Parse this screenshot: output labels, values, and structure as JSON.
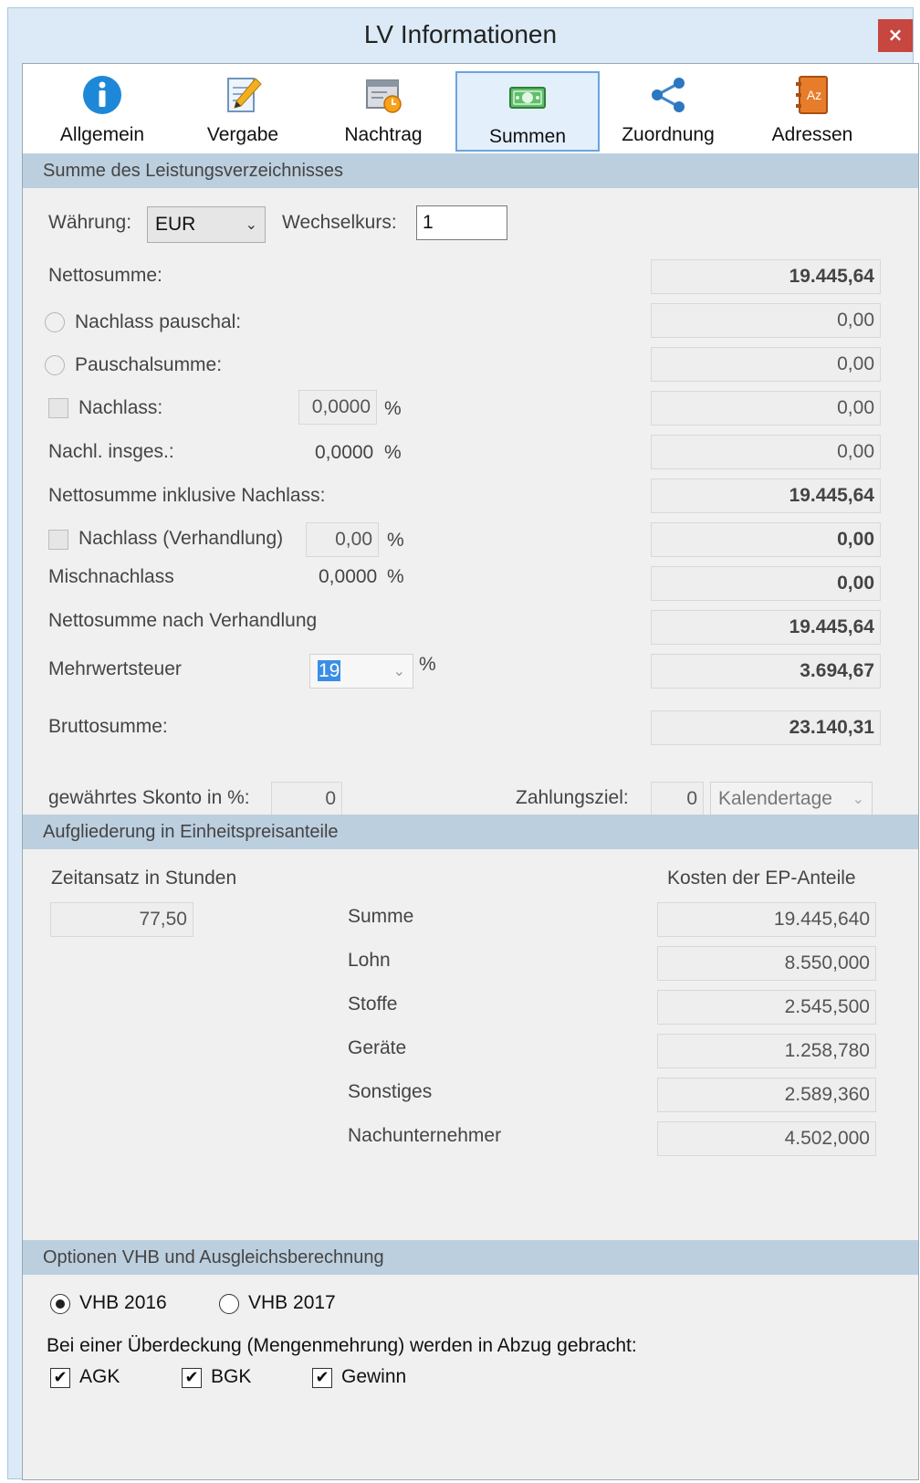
{
  "window": {
    "title": "LV Informationen",
    "close_glyph": "×"
  },
  "tabs": [
    {
      "label": "Allgemein",
      "icon": "info-icon"
    },
    {
      "label": "Vergabe",
      "icon": "notepad-pencil-icon"
    },
    {
      "label": "Nachtrag",
      "icon": "document-clock-icon"
    },
    {
      "label": "Summen",
      "icon": "money-icon",
      "active": true
    },
    {
      "label": "Zuordnung",
      "icon": "share-icon"
    },
    {
      "label": "Adressen",
      "icon": "address-book-icon"
    }
  ],
  "summe": {
    "section_title": "Summe des Leistungsverzeichnisses",
    "waehrung_label": "Währung:",
    "waehrung_value": "EUR",
    "wechselkurs_label": "Wechselkurs:",
    "wechselkurs_value": "1",
    "nettosumme_label": "Nettosumme:",
    "nettosumme_value": "19.445,64",
    "nachlass_pauschal_label": "Nachlass pauschal:",
    "nachlass_pauschal_value": "0,00",
    "pauschalsumme_label": "Pauschalsumme:",
    "pauschalsumme_value": "0,00",
    "nachlass_label": "Nachlass:",
    "nachlass_pct": "0,0000",
    "nachlass_value": "0,00",
    "nachl_insges_label": "Nachl. insges.:",
    "nachl_insges_pct": "0,0000",
    "nachl_insges_value": "0,00",
    "netto_inkl_label": "Nettosumme inklusive Nachlass:",
    "netto_inkl_value": "19.445,64",
    "nachlass_verh_label": "Nachlass (Verhandlung)",
    "nachlass_verh_pct": "0,00",
    "nachlass_verh_value": "0,00",
    "mischnachlass_label": "Mischnachlass",
    "mischnachlass_pct": "0,0000",
    "mischnachlass_value": "0,00",
    "netto_verh_label": "Nettosumme nach Verhandlung",
    "netto_verh_value": "19.445,64",
    "mwst_label": "Mehrwertsteuer",
    "mwst_pct": "19",
    "mwst_value": "3.694,67",
    "brutto_label": "Bruttosumme:",
    "brutto_value": "23.140,31",
    "skonto_label": "gewährtes Skonto in %:",
    "skonto_value": "0",
    "zahlungsziel_label": "Zahlungsziel:",
    "zahlungsziel_value": "0",
    "zahlungsziel_unit": "Kalendertage",
    "percent_sign": "%"
  },
  "aufgliederung": {
    "section_title": "Aufgliederung in Einheitspreisanteile",
    "zeitansatz_label": "Zeitansatz in Stunden",
    "zeitansatz_value": "77,50",
    "kosten_label": "Kosten der EP-Anteile",
    "rows": [
      {
        "label": "Summe",
        "value": "19.445,640"
      },
      {
        "label": "Lohn",
        "value": "8.550,000"
      },
      {
        "label": "Stoffe",
        "value": "2.545,500"
      },
      {
        "label": "Geräte",
        "value": "1.258,780"
      },
      {
        "label": "Sonstiges",
        "value": "2.589,360"
      },
      {
        "label": "Nachunternehmer",
        "value": "4.502,000"
      }
    ]
  },
  "optionen": {
    "section_title": "Optionen VHB und Ausgleichsberechnung",
    "vhb2016": "VHB 2016",
    "vhb2017": "VHB 2017",
    "ueberdeckung_label": "Bei einer Überdeckung (Mengenmehrung) werden in Abzug gebracht:",
    "agk": "AGK",
    "bgk": "BGK",
    "gewinn": "Gewinn",
    "check_glyph": "✔"
  }
}
